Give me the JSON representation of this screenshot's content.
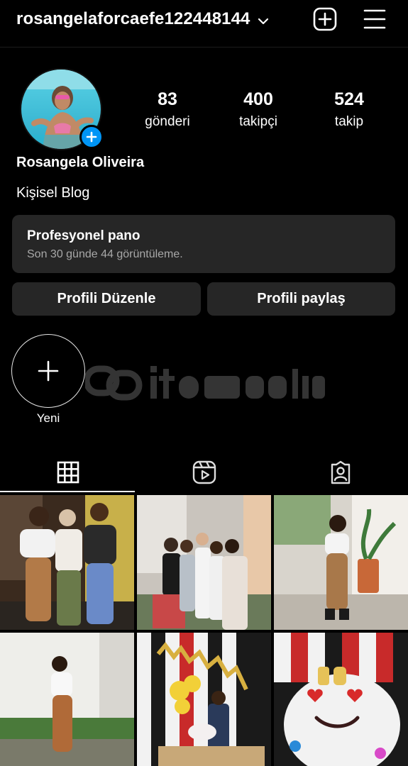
{
  "header": {
    "username": "rosangelaforcaefe122448144",
    "icons": {
      "dropdown": "chevron-down-icon",
      "create": "plus-square-icon",
      "menu": "hamburger-menu-icon"
    }
  },
  "profile": {
    "avatar_icon": "profile-photo",
    "add_story_icon": "plus-icon",
    "stats": [
      {
        "value": "83",
        "label": "gönderi"
      },
      {
        "value": "400",
        "label": "takipçi"
      },
      {
        "value": "524",
        "label": "takip"
      }
    ],
    "full_name": "Rosangela Oliveira",
    "category": "Kişisel Blog"
  },
  "dashboard": {
    "title": "Profesyonel pano",
    "subtitle": "Son 30 günde 44 görüntüleme."
  },
  "actions": {
    "edit_label": "Profili Düzenle",
    "share_label": "Profili paylaş"
  },
  "highlights": {
    "new_label": "Yeni"
  },
  "tabs": [
    {
      "icon": "grid-icon",
      "active": true
    },
    {
      "icon": "reels-icon",
      "active": false
    },
    {
      "icon": "tagged-icon",
      "active": false
    }
  ],
  "posts": [
    {
      "description": "three women posing"
    },
    {
      "description": "group photo outdoors"
    },
    {
      "description": "woman posing in lobby"
    },
    {
      "description": "woman by white wall"
    },
    {
      "description": "party table with balloons"
    },
    {
      "description": "birthday cake with candles"
    }
  ],
  "colors": {
    "background": "#000000",
    "card": "#262626",
    "accent": "#0095f6",
    "muted_text": "#a8a8a8"
  }
}
